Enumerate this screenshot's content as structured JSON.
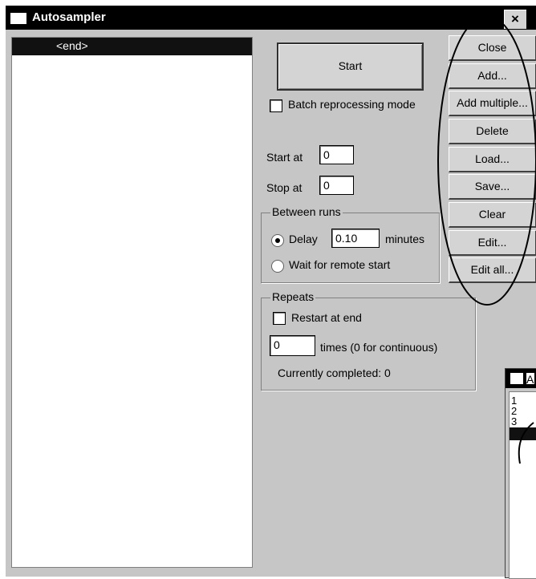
{
  "window": {
    "title": "Autosampler",
    "close_glyph": "×"
  },
  "queue": {
    "items": [
      "<end>"
    ],
    "selected_index": 0
  },
  "controls": {
    "start_label": "Start",
    "batch_label": "Batch reprocessing mode",
    "batch_checked": false,
    "start_at_label": "Start at",
    "start_at_value": "0",
    "stop_at_label": "Stop at",
    "stop_at_value": "0"
  },
  "between_runs": {
    "title": "Between runs",
    "delay_label": "Delay",
    "delay_value": "0.10",
    "delay_unit": "minutes",
    "remote_label": "Wait for remote start",
    "selected": "delay"
  },
  "repeats": {
    "title": "Repeats",
    "restart_label": "Restart at end",
    "restart_checked": false,
    "times_value": "0",
    "times_label": "times (0 for continuous)",
    "completed_text": "Currently completed: 0"
  },
  "side_buttons": [
    "Close",
    "Add...",
    "Add multiple...",
    "Delete",
    "Load...",
    "Save...",
    "Clear",
    "Edit...",
    "Edit all..."
  ],
  "second_window": {
    "title_fragment": "A",
    "rows": [
      "1",
      "2",
      "3"
    ]
  },
  "colors": {
    "titlebar": "#000000",
    "window_bg": "#c6c6c6",
    "selection": "#111111"
  }
}
